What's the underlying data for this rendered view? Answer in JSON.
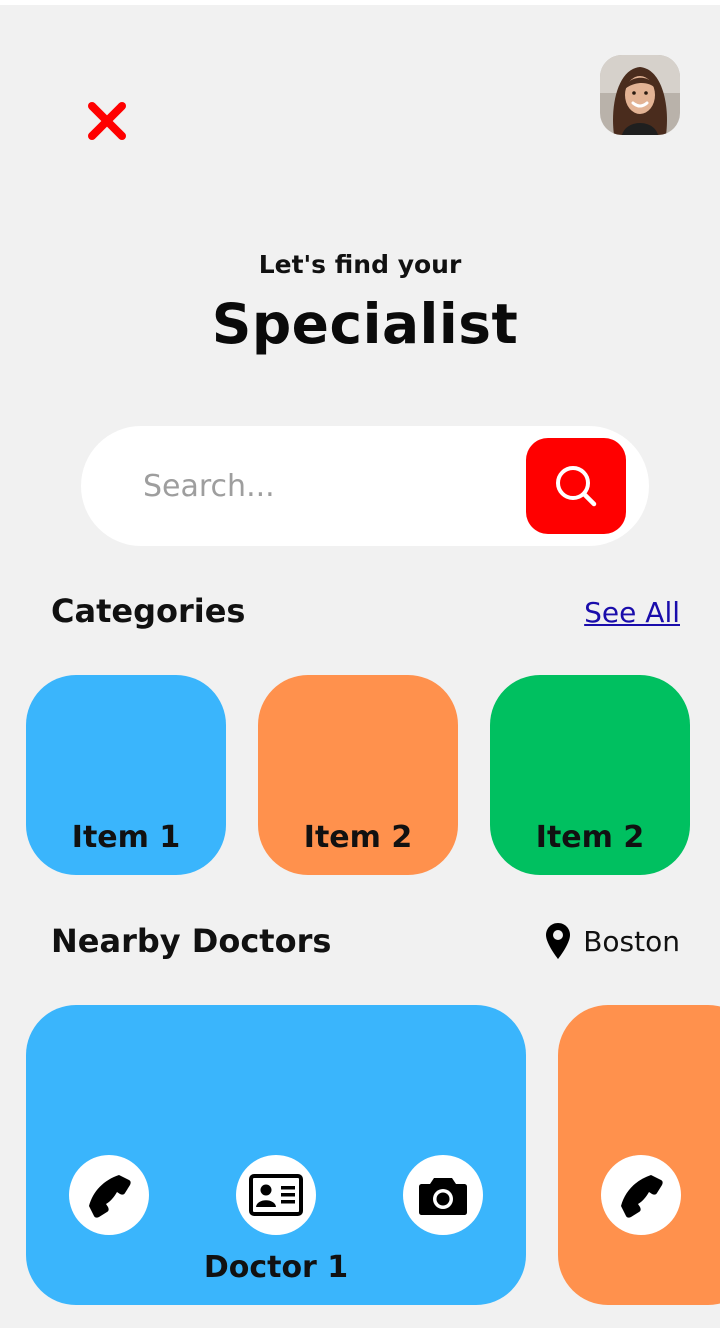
{
  "header": {
    "close_icon": "close-x-icon",
    "close_color": "#ff0000",
    "avatar": "profile-avatar"
  },
  "hero": {
    "subtitle": "Let's find your",
    "title": "Specialist"
  },
  "search": {
    "placeholder": "Search...",
    "value": "",
    "button_icon": "search-icon",
    "button_color": "#ff0000"
  },
  "categories": {
    "heading": "Categories",
    "see_all": "See All",
    "items": [
      {
        "label": "Item 1",
        "color": "#3ab5fc"
      },
      {
        "label": "Item 2",
        "color": "#ff914d"
      },
      {
        "label": "Item 2",
        "color": "#00c060"
      }
    ]
  },
  "nearby": {
    "heading": "Nearby Doctors",
    "location_icon": "map-pin-icon",
    "location": "Boston",
    "doctors": [
      {
        "name": "Doctor 1",
        "color": "#3ab5fc",
        "actions": [
          "phone-icon",
          "id-card-icon",
          "camera-icon"
        ]
      },
      {
        "name": "",
        "color": "#ff914d",
        "actions": [
          "phone-icon"
        ]
      }
    ]
  }
}
